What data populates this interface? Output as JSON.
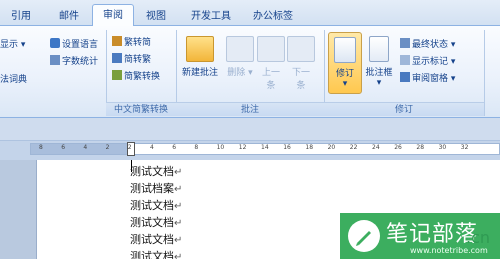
{
  "tabs": [
    "引用",
    "邮件",
    "审阅",
    "视图",
    "开发工具",
    "办公标签"
  ],
  "active_tab": "审阅",
  "proofing": {
    "item1": "显示",
    "item2": "设置语言",
    "item3": "字数统计",
    "item4": "法词典"
  },
  "chinese_group": {
    "item1": "繁转简",
    "item2": "简转繁",
    "item3": "简繁转换",
    "label": "中文简繁转换"
  },
  "comments_group": {
    "new_comment": "新建批注",
    "delete": "删除",
    "prev_1": "上一",
    "prev_2": "条",
    "next_1": "下一",
    "next_2": "条",
    "label": "批注"
  },
  "tracking_group": {
    "track": "修订",
    "balloons": "批注框",
    "final_state": "最终状态",
    "show_markup": "显示标记",
    "review_pane": "审阅窗格",
    "label": "修订"
  },
  "ruler_ticks": [
    "8",
    "6",
    "4",
    "2",
    "2",
    "4",
    "6",
    "8",
    "10",
    "12",
    "14",
    "16",
    "18",
    "20",
    "22",
    "24",
    "26",
    "28",
    "30",
    "32"
  ],
  "document_lines": [
    "测试文档",
    "测试档案",
    "测试文档",
    "测试文档",
    "测试文档",
    "测试文档"
  ],
  "paragraph_mark": "↵",
  "watermark": {
    "title": "笔记部落",
    "url": "www.notetribe.com",
    "cn": ".cn"
  },
  "colors": {
    "ribbon_text": "#15428b",
    "active_button": "#ffc84f",
    "watermark_green": "#3cae5f"
  }
}
